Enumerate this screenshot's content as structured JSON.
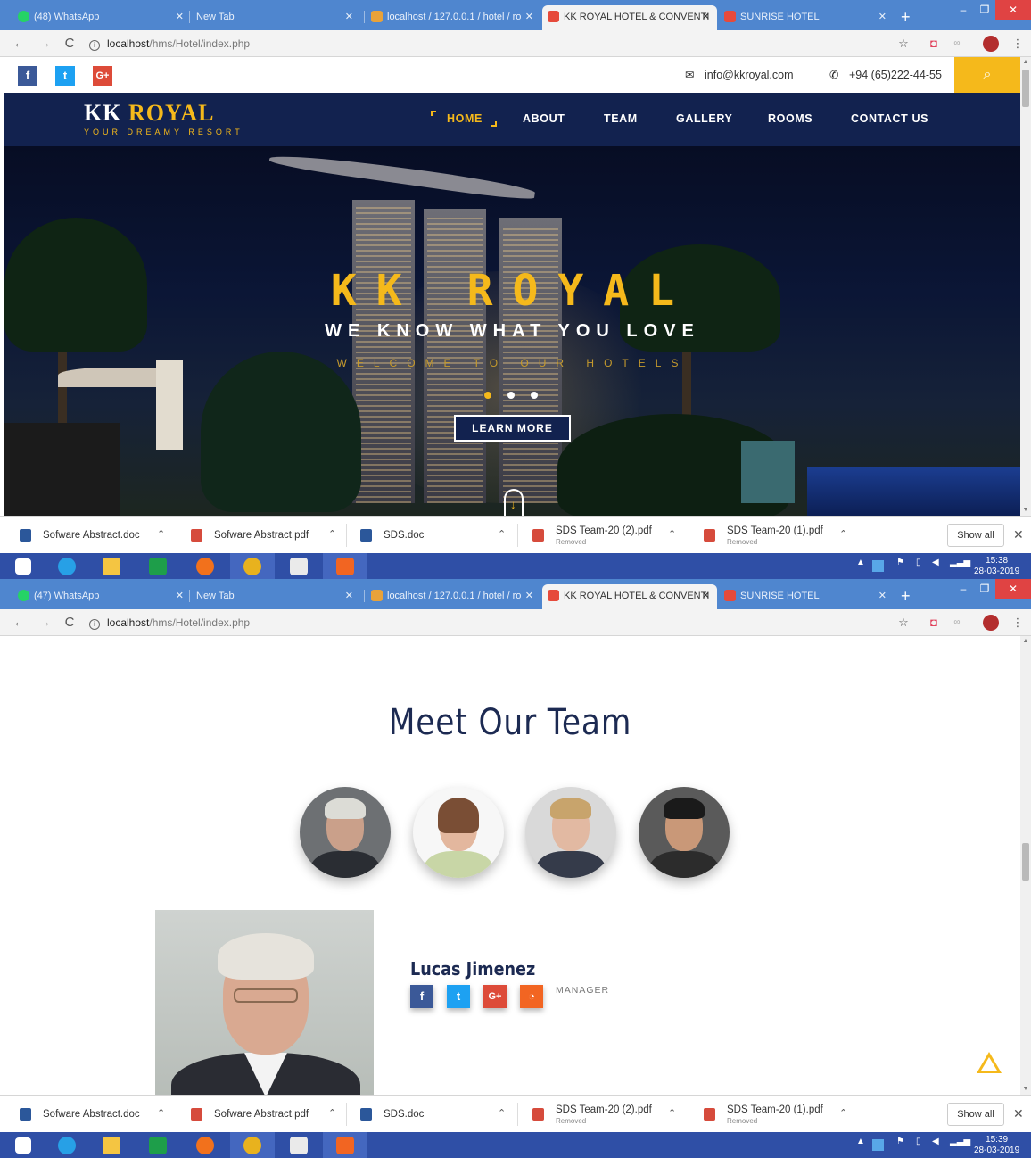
{
  "shot1": {
    "tabs": [
      {
        "label": "(48) WhatsApp"
      },
      {
        "label": "New Tab"
      },
      {
        "label": "localhost / 127.0.0.1 / hotel / ro"
      },
      {
        "label": "KK ROYAL HOTEL & CONVENTI"
      },
      {
        "label": "SUNRISE HOTEL"
      }
    ],
    "url_host": "localhost",
    "url_path": "/hms/Hotel/index.php",
    "clock_time": "15:38",
    "clock_date": "28-03-2019"
  },
  "shot2": {
    "tabs": [
      {
        "label": "(47) WhatsApp"
      },
      {
        "label": "New Tab"
      },
      {
        "label": "localhost / 127.0.0.1 / hotel / ro"
      },
      {
        "label": "KK ROYAL HOTEL & CONVENTI"
      },
      {
        "label": "SUNRISE HOTEL"
      }
    ],
    "url_host": "localhost",
    "url_path": "/hms/Hotel/index.php",
    "clock_time": "15:39",
    "clock_date": "28-03-2019"
  },
  "site": {
    "email": "info@kkroyal.com",
    "phone": "+94 (65)222-44-55",
    "logo_kk": "KK",
    "logo_royal": "ROYAL",
    "logo_tagline": "YOUR DREAMY RESORT",
    "menu": [
      "HOME",
      "ABOUT",
      "TEAM",
      "GALLERY",
      "ROOMS",
      "CONTACT US"
    ],
    "hero_title": "KK ROYAL",
    "hero_tagline": "WE KNOW WHAT YOU LOVE",
    "hero_welcome": "WELCOME TO OUR HOTELS",
    "learn_more": "LEARN MORE",
    "team_title": "Meet Our Team",
    "member_name": "Lucas Jimenez",
    "member_role": "MANAGER"
  },
  "downloads": [
    {
      "name": "Sofware Abstract.doc",
      "type": "doc",
      "status": ""
    },
    {
      "name": "Sofware Abstract.pdf",
      "type": "pdf",
      "status": ""
    },
    {
      "name": "SDS.doc",
      "type": "doc",
      "status": ""
    },
    {
      "name": "SDS Team-20 (2).pdf",
      "type": "pdf",
      "status": "Removed"
    },
    {
      "name": "SDS Team-20 (1).pdf",
      "type": "pdf",
      "status": "Removed"
    }
  ],
  "show_all": "Show all",
  "colors": {
    "accent": "#f5b91b",
    "navy": "#12224f",
    "tab_strip": "#4f86cf",
    "taskbar": "#2f4fa6"
  }
}
